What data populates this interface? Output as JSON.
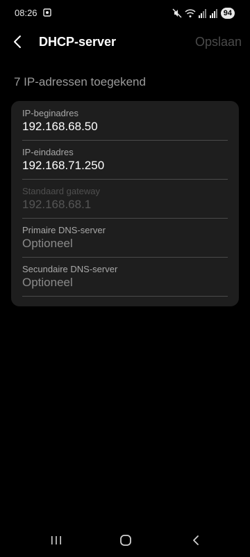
{
  "status_bar": {
    "time": "08:26",
    "battery": "94",
    "icons": [
      "screen-record-icon",
      "mute-icon",
      "wifi-icon",
      "signal-icon",
      "signal-icon"
    ]
  },
  "header": {
    "title": "DHCP-server",
    "save_label": "Opslaan"
  },
  "summary": "7 IP-adressen toegekend",
  "fields": [
    {
      "label": "IP-beginadres",
      "value": "192.168.68.50",
      "state": "filled"
    },
    {
      "label": "IP-eindadres",
      "value": "192.168.71.250",
      "state": "filled"
    },
    {
      "label": "Standaard gateway",
      "value": "192.168.68.1",
      "state": "disabled"
    },
    {
      "label": "Primaire DNS-server",
      "value": "Optioneel",
      "state": "placeholder"
    },
    {
      "label": "Secundaire DNS-server",
      "value": "Optioneel",
      "state": "placeholder"
    }
  ],
  "nav_bar": {
    "icons": [
      "recent-apps-icon",
      "home-icon",
      "back-icon"
    ]
  },
  "colors": {
    "background": "#000000",
    "card": "#1e1e1e",
    "save_disabled": "#4a4a4a",
    "text_secondary": "#9b9b9b"
  }
}
